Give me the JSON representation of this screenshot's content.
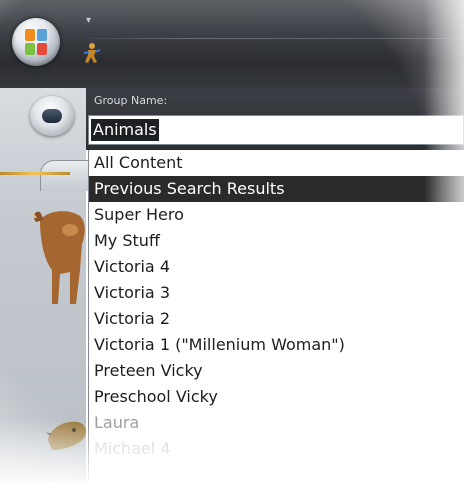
{
  "window": {
    "qat_icon": "chevron-down-icon",
    "app_icon": "figure-icon",
    "menu_button_icon": "office-orb-icon"
  },
  "sidebar": {
    "nav_button_icon": "back-arrow-icon",
    "thumbnails": [
      "cow-icon",
      "creature-icon"
    ]
  },
  "group": {
    "label": "Group Name:",
    "value": "Animals"
  },
  "dropdown": {
    "items": [
      "All Content",
      "Previous Search Results",
      "Super Hero",
      "My Stuff",
      "Victoria 4",
      "Victoria 3",
      "Victoria 2",
      "Victoria 1 (\"Millenium Woman\")",
      "Preteen Vicky",
      "Preschool Vicky",
      "Laura",
      "Michael 4"
    ],
    "selected_index": 1
  },
  "colors": {
    "chrome_dark": "#2c2e33",
    "selection": "#2b2a2a",
    "accent_gold": "#f2c45a"
  }
}
